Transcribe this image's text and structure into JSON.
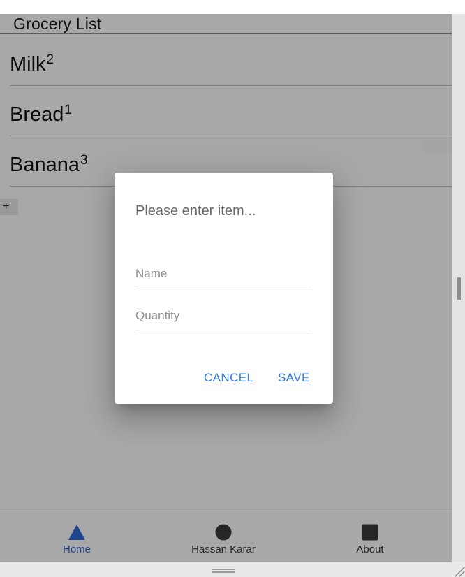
{
  "header": {
    "title": "Grocery List"
  },
  "items": [
    {
      "name": "Milk",
      "quantity": "2"
    },
    {
      "name": "Bread",
      "quantity": "1"
    },
    {
      "name": "Banana",
      "quantity": "3"
    }
  ],
  "add_button": {
    "label": "+"
  },
  "dialog": {
    "title": "Please enter item...",
    "name_field": {
      "placeholder": "Name",
      "value": ""
    },
    "quantity_field": {
      "placeholder": "Quantity",
      "value": ""
    },
    "cancel_label": "CANCEL",
    "save_label": "SAVE"
  },
  "nav": {
    "tabs": [
      {
        "label": "Home",
        "icon": "triangle-icon",
        "active": true
      },
      {
        "label": "Hassan Karar",
        "icon": "circle-icon",
        "active": false
      },
      {
        "label": "About",
        "icon": "square-icon",
        "active": false
      }
    ]
  },
  "colors": {
    "accent": "#2f7ae5",
    "active_tab": "#2f6ad6",
    "icon": "#3a3a3a"
  }
}
